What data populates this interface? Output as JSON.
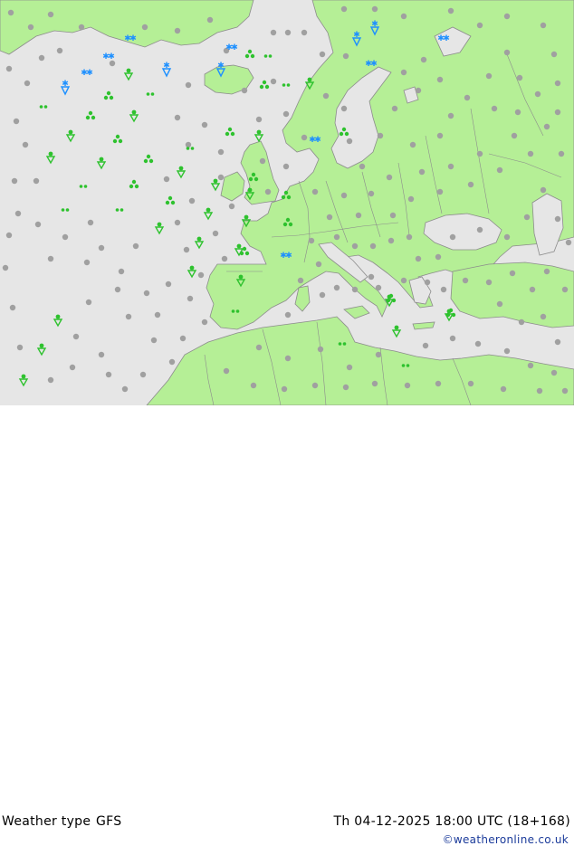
{
  "footer": {
    "title": "Weather type",
    "model": "GFS",
    "valid_time": "Th 04-12-2025 18:00 UTC (18+168)",
    "credit": "©weatheronline.co.uk"
  },
  "colors": {
    "sea": "#e6e6e6",
    "land": "#b5ef96",
    "border": "#8c8c8c",
    "rain": "#2ec22e",
    "snow": "#1e90ff",
    "cloud": "#a0a0a0"
  },
  "legend_icons": [
    "cloud-icon",
    "drizzle-icon",
    "rain-icon",
    "rain-shower-icon",
    "snow-icon",
    "snow-shower-icon"
  ]
}
